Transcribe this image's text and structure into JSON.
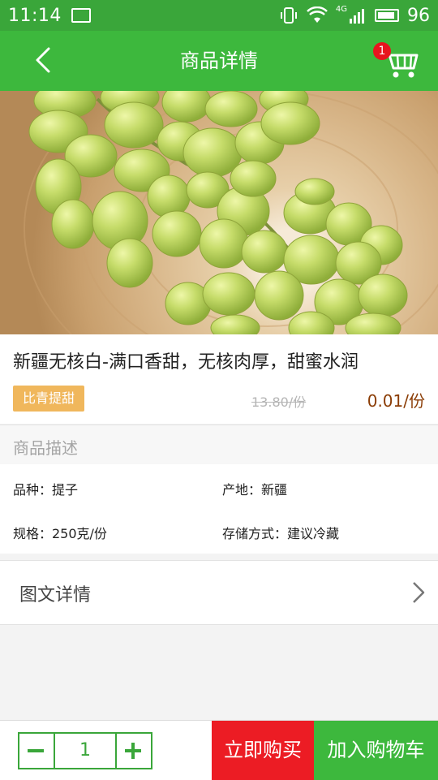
{
  "status_bar": {
    "time": "11:14",
    "network": "4G",
    "battery": "96"
  },
  "nav": {
    "title": "商品详情",
    "cart_badge": "1"
  },
  "product": {
    "name": "新疆无核白-满口香甜，无核肉厚，甜蜜水润",
    "tag": "比青提甜",
    "old_price": "13.80/份",
    "price": "0.01/份"
  },
  "description": {
    "heading": "商品描述",
    "variety": "品种：提子",
    "origin": "产地：新疆",
    "spec": "规格：250克/份",
    "storage": "存储方式：建议冷藏"
  },
  "detail_link": {
    "label": "图文详情"
  },
  "bottom_bar": {
    "quantity": "1",
    "buy_now": "立即购买",
    "add_to_cart": "加入购物车"
  },
  "colors": {
    "primary_green": "#3db83d",
    "buy_red": "#ec1c24",
    "tag_orange": "#f0b75c",
    "price_brown": "#8b3d06"
  }
}
